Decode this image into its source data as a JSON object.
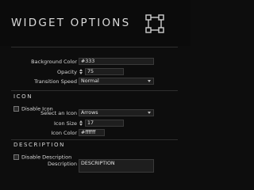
{
  "header": {
    "title": "WIDGET OPTIONS",
    "icon": "widget-layout-icon"
  },
  "general": {
    "background_color": {
      "label": "Background Color",
      "value": "#333"
    },
    "opacity": {
      "label": "Opacity",
      "value": "75"
    },
    "transition_speed": {
      "label": "Transition Speed",
      "value": "Normal"
    }
  },
  "icon_section": {
    "title": "ICON",
    "disable": {
      "label": "Disable Icon",
      "checked": false
    },
    "select": {
      "label": "Select an Icon",
      "value": "Arrows"
    },
    "size": {
      "label": "Icon Size",
      "value": "17"
    },
    "color": {
      "label": "Icon Color",
      "value": "#ffffff"
    }
  },
  "description_section": {
    "title": "DESCRIPTION",
    "disable": {
      "label": "Disable Description",
      "checked": false
    },
    "description": {
      "label": "Description",
      "value": "DESCRIPTION"
    }
  }
}
